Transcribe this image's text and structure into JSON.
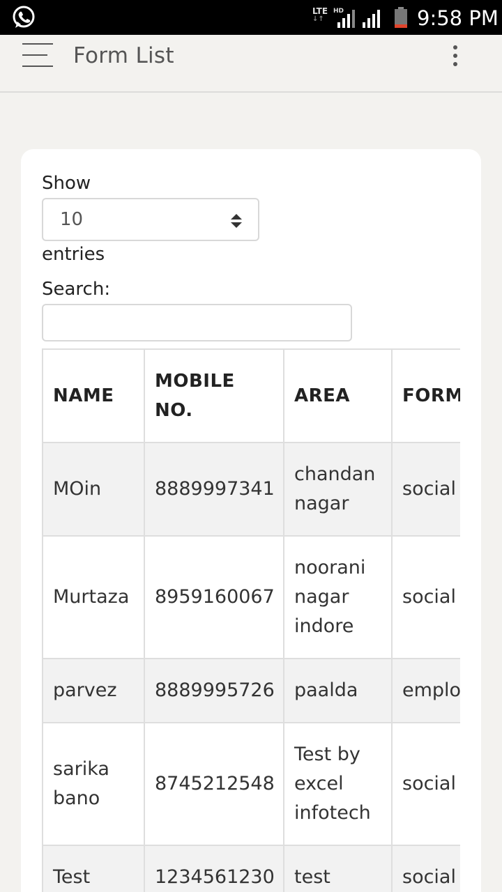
{
  "status_bar": {
    "network": "LTE",
    "hd": "HD",
    "time": "9:58 PM",
    "icons": [
      "whatsapp-icon",
      "signal-icon",
      "signal-icon",
      "battery-icon"
    ]
  },
  "app_bar": {
    "title": "Form List",
    "menu_icon": "hamburger-menu-icon",
    "more_icon": "more-vertical-icon"
  },
  "controls": {
    "show_label": "Show",
    "entries_value": "10",
    "entries_label": "entries",
    "search_label": "Search:",
    "search_value": ""
  },
  "table": {
    "columns": [
      "NAME",
      "MOBILE NO.",
      "AREA",
      "FORM"
    ],
    "rows": [
      {
        "name": "MOin",
        "mobile": "8889997341",
        "area": "chandan nagar",
        "form": "social"
      },
      {
        "name": "Murtaza",
        "mobile": "8959160067",
        "area": "noorani nagar indore",
        "form": "social"
      },
      {
        "name": "parvez",
        "mobile": "8889995726",
        "area": "paalda",
        "form": "employment"
      },
      {
        "name": "sarika bano",
        "mobile": "8745212548",
        "area": "Test by excel infotech",
        "form": "social"
      },
      {
        "name": "Test",
        "mobile": "1234561230",
        "area": "test",
        "form": "social"
      }
    ]
  }
}
